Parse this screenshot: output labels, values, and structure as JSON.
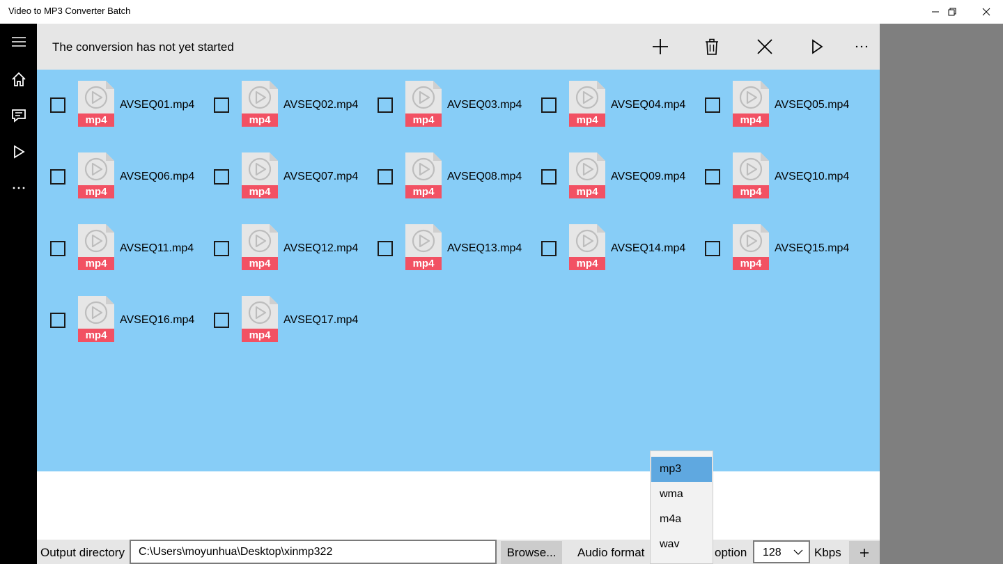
{
  "window": {
    "title": "Video to MP3 Converter Batch"
  },
  "nav": {
    "items": [
      {
        "icon": "hamburger-menu-icon"
      },
      {
        "icon": "home-icon"
      },
      {
        "icon": "feedback-icon"
      },
      {
        "icon": "play-icon"
      },
      {
        "icon": "more-icon"
      }
    ]
  },
  "commandbar": {
    "status": "The conversion has not yet started",
    "buttons": [
      {
        "icon": "add-icon"
      },
      {
        "icon": "delete-icon"
      },
      {
        "icon": "clear-icon"
      },
      {
        "icon": "start-icon"
      },
      {
        "icon": "more-icon"
      }
    ]
  },
  "files": [
    {
      "name": "AVSEQ01.mp4",
      "badge": "mp4",
      "checked": false
    },
    {
      "name": "AVSEQ02.mp4",
      "badge": "mp4",
      "checked": false
    },
    {
      "name": "AVSEQ03.mp4",
      "badge": "mp4",
      "checked": false
    },
    {
      "name": "AVSEQ04.mp4",
      "badge": "mp4",
      "checked": false
    },
    {
      "name": "AVSEQ05.mp4",
      "badge": "mp4",
      "checked": false
    },
    {
      "name": "AVSEQ06.mp4",
      "badge": "mp4",
      "checked": false
    },
    {
      "name": "AVSEQ07.mp4",
      "badge": "mp4",
      "checked": false
    },
    {
      "name": "AVSEQ08.mp4",
      "badge": "mp4",
      "checked": false
    },
    {
      "name": "AVSEQ09.mp4",
      "badge": "mp4",
      "checked": false
    },
    {
      "name": "AVSEQ10.mp4",
      "badge": "mp4",
      "checked": false
    },
    {
      "name": "AVSEQ11.mp4",
      "badge": "mp4",
      "checked": false
    },
    {
      "name": "AVSEQ12.mp4",
      "badge": "mp4",
      "checked": false
    },
    {
      "name": "AVSEQ13.mp4",
      "badge": "mp4",
      "checked": false
    },
    {
      "name": "AVSEQ14.mp4",
      "badge": "mp4",
      "checked": false
    },
    {
      "name": "AVSEQ15.mp4",
      "badge": "mp4",
      "checked": false
    },
    {
      "name": "AVSEQ16.mp4",
      "badge": "mp4",
      "checked": false
    },
    {
      "name": "AVSEQ17.mp4",
      "badge": "mp4",
      "checked": false
    }
  ],
  "bottom": {
    "output_label": "Output directory",
    "output_path": "C:\\Users\\moyunhua\\Desktop\\xinmp322",
    "browse_label": "Browse...",
    "format_label": "Audio format",
    "option_label": "option",
    "bitrate_value": "128",
    "kbps_label": "Kbps"
  },
  "format_dropdown": {
    "options": [
      "mp3",
      "wma",
      "m4a",
      "wav"
    ],
    "selected": "mp3"
  },
  "colors": {
    "grid_background": "#87cdf7",
    "badge_red": "#f25163",
    "selected_option": "#5fa8e0",
    "rail": "#000000",
    "side_panel": "#7f7f7f"
  }
}
